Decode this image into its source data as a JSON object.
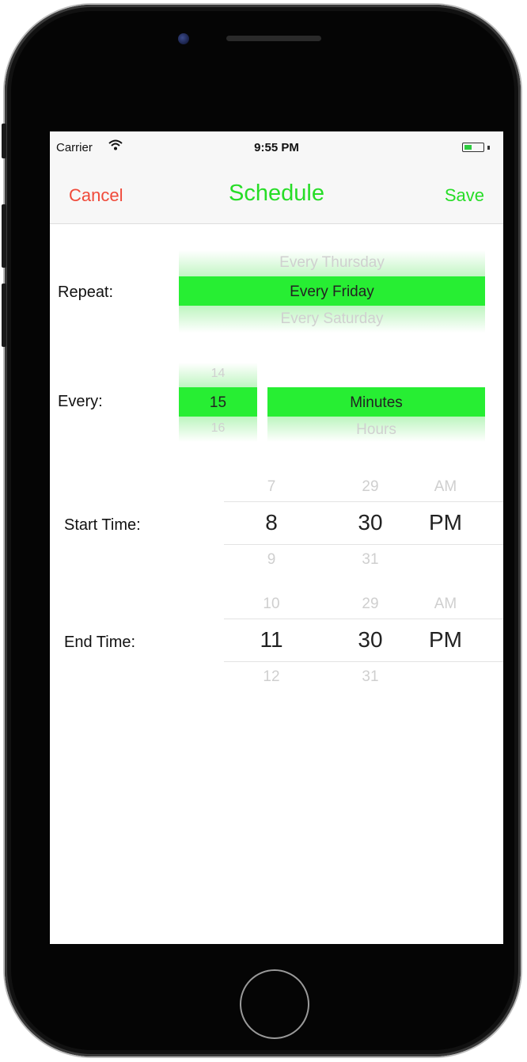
{
  "status_bar": {
    "carrier": "Carrier",
    "time": "9:55 PM"
  },
  "nav": {
    "cancel": "Cancel",
    "title": "Schedule",
    "save": "Save"
  },
  "repeat": {
    "label": "Repeat:",
    "options": [
      "Every Thursday",
      "Every Friday",
      "Every Saturday"
    ],
    "selected_index": 1
  },
  "every": {
    "label": "Every:",
    "numbers": [
      "14",
      "15",
      "16"
    ],
    "units": [
      "Minutes",
      "Hours"
    ],
    "selected_number_index": 1,
    "selected_unit_index": 0
  },
  "start_time": {
    "label": "Start Time:",
    "hours": [
      "7",
      "8",
      "9"
    ],
    "minutes": [
      "29",
      "30",
      "31"
    ],
    "periods": [
      "AM",
      "PM"
    ]
  },
  "end_time": {
    "label": "End Time:",
    "hours": [
      "10",
      "11",
      "12"
    ],
    "minutes": [
      "29",
      "30",
      "31"
    ],
    "periods": [
      "AM",
      "PM"
    ]
  },
  "colors": {
    "accent_green": "#27dd27",
    "highlight_green": "#27ee33",
    "cancel_red": "#f04a3a"
  },
  "icons": {
    "wifi": "wifi-icon",
    "battery": "battery-icon"
  }
}
